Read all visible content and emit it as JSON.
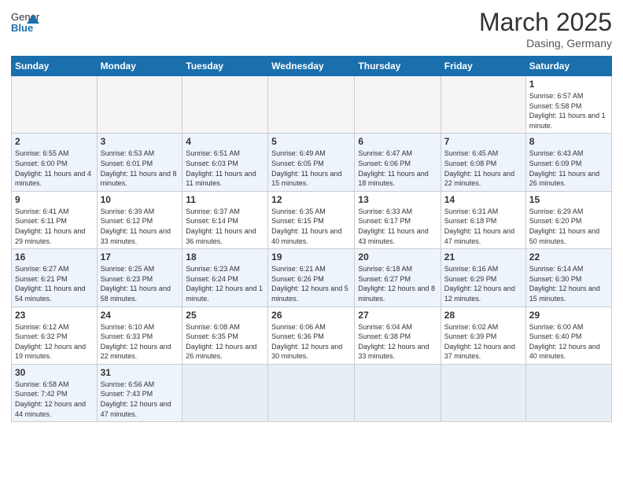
{
  "header": {
    "logo_general": "General",
    "logo_blue": "Blue",
    "title": "March 2025",
    "subtitle": "Dasing, Germany"
  },
  "weekdays": [
    "Sunday",
    "Monday",
    "Tuesday",
    "Wednesday",
    "Thursday",
    "Friday",
    "Saturday"
  ],
  "weeks": [
    [
      {
        "day": "",
        "info": ""
      },
      {
        "day": "",
        "info": ""
      },
      {
        "day": "",
        "info": ""
      },
      {
        "day": "",
        "info": ""
      },
      {
        "day": "",
        "info": ""
      },
      {
        "day": "",
        "info": ""
      },
      {
        "day": "1",
        "info": "Sunrise: 6:57 AM\nSunset: 5:58 PM\nDaylight: 11 hours\nand 1 minute."
      }
    ],
    [
      {
        "day": "2",
        "info": "Sunrise: 6:55 AM\nSunset: 6:00 PM\nDaylight: 11 hours\nand 4 minutes."
      },
      {
        "day": "3",
        "info": "Sunrise: 6:53 AM\nSunset: 6:01 PM\nDaylight: 11 hours\nand 8 minutes."
      },
      {
        "day": "4",
        "info": "Sunrise: 6:51 AM\nSunset: 6:03 PM\nDaylight: 11 hours\nand 11 minutes."
      },
      {
        "day": "5",
        "info": "Sunrise: 6:49 AM\nSunset: 6:05 PM\nDaylight: 11 hours\nand 15 minutes."
      },
      {
        "day": "6",
        "info": "Sunrise: 6:47 AM\nSunset: 6:06 PM\nDaylight: 11 hours\nand 18 minutes."
      },
      {
        "day": "7",
        "info": "Sunrise: 6:45 AM\nSunset: 6:08 PM\nDaylight: 11 hours\nand 22 minutes."
      },
      {
        "day": "8",
        "info": "Sunrise: 6:43 AM\nSunset: 6:09 PM\nDaylight: 11 hours\nand 26 minutes."
      }
    ],
    [
      {
        "day": "9",
        "info": "Sunrise: 6:41 AM\nSunset: 6:11 PM\nDaylight: 11 hours\nand 29 minutes."
      },
      {
        "day": "10",
        "info": "Sunrise: 6:39 AM\nSunset: 6:12 PM\nDaylight: 11 hours\nand 33 minutes."
      },
      {
        "day": "11",
        "info": "Sunrise: 6:37 AM\nSunset: 6:14 PM\nDaylight: 11 hours\nand 36 minutes."
      },
      {
        "day": "12",
        "info": "Sunrise: 6:35 AM\nSunset: 6:15 PM\nDaylight: 11 hours\nand 40 minutes."
      },
      {
        "day": "13",
        "info": "Sunrise: 6:33 AM\nSunset: 6:17 PM\nDaylight: 11 hours\nand 43 minutes."
      },
      {
        "day": "14",
        "info": "Sunrise: 6:31 AM\nSunset: 6:18 PM\nDaylight: 11 hours\nand 47 minutes."
      },
      {
        "day": "15",
        "info": "Sunrise: 6:29 AM\nSunset: 6:20 PM\nDaylight: 11 hours\nand 50 minutes."
      }
    ],
    [
      {
        "day": "16",
        "info": "Sunrise: 6:27 AM\nSunset: 6:21 PM\nDaylight: 11 hours\nand 54 minutes."
      },
      {
        "day": "17",
        "info": "Sunrise: 6:25 AM\nSunset: 6:23 PM\nDaylight: 11 hours\nand 58 minutes."
      },
      {
        "day": "18",
        "info": "Sunrise: 6:23 AM\nSunset: 6:24 PM\nDaylight: 12 hours\nand 1 minute."
      },
      {
        "day": "19",
        "info": "Sunrise: 6:21 AM\nSunset: 6:26 PM\nDaylight: 12 hours\nand 5 minutes."
      },
      {
        "day": "20",
        "info": "Sunrise: 6:18 AM\nSunset: 6:27 PM\nDaylight: 12 hours\nand 8 minutes."
      },
      {
        "day": "21",
        "info": "Sunrise: 6:16 AM\nSunset: 6:29 PM\nDaylight: 12 hours\nand 12 minutes."
      },
      {
        "day": "22",
        "info": "Sunrise: 6:14 AM\nSunset: 6:30 PM\nDaylight: 12 hours\nand 15 minutes."
      }
    ],
    [
      {
        "day": "23",
        "info": "Sunrise: 6:12 AM\nSunset: 6:32 PM\nDaylight: 12 hours\nand 19 minutes."
      },
      {
        "day": "24",
        "info": "Sunrise: 6:10 AM\nSunset: 6:33 PM\nDaylight: 12 hours\nand 22 minutes."
      },
      {
        "day": "25",
        "info": "Sunrise: 6:08 AM\nSunset: 6:35 PM\nDaylight: 12 hours\nand 26 minutes."
      },
      {
        "day": "26",
        "info": "Sunrise: 6:06 AM\nSunset: 6:36 PM\nDaylight: 12 hours\nand 30 minutes."
      },
      {
        "day": "27",
        "info": "Sunrise: 6:04 AM\nSunset: 6:38 PM\nDaylight: 12 hours\nand 33 minutes."
      },
      {
        "day": "28",
        "info": "Sunrise: 6:02 AM\nSunset: 6:39 PM\nDaylight: 12 hours\nand 37 minutes."
      },
      {
        "day": "29",
        "info": "Sunrise: 6:00 AM\nSunset: 6:40 PM\nDaylight: 12 hours\nand 40 minutes."
      }
    ],
    [
      {
        "day": "30",
        "info": "Sunrise: 6:58 AM\nSunset: 7:42 PM\nDaylight: 12 hours\nand 44 minutes."
      },
      {
        "day": "31",
        "info": "Sunrise: 6:56 AM\nSunset: 7:43 PM\nDaylight: 12 hours\nand 47 minutes."
      },
      {
        "day": "",
        "info": ""
      },
      {
        "day": "",
        "info": ""
      },
      {
        "day": "",
        "info": ""
      },
      {
        "day": "",
        "info": ""
      },
      {
        "day": "",
        "info": ""
      }
    ]
  ]
}
